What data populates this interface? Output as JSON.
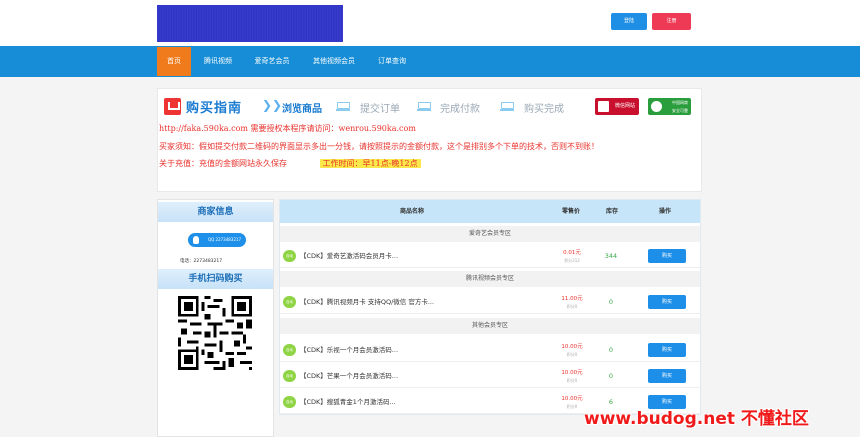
{
  "header": {
    "login_label": "登陆",
    "register_label": "注册"
  },
  "nav": {
    "items": [
      "首页",
      "腾讯视频",
      "爱奇艺会员",
      "其他视频会员",
      "订单查询"
    ]
  },
  "guide": {
    "title": "购买指南",
    "steps": [
      "浏览商品",
      "提交订单",
      "完成付款",
      "购买完成"
    ],
    "badge_red": "微信网站",
    "badge_green": [
      "中国网商",
      "安全可靠"
    ],
    "line1": "http://faka.590ka.com   需要授权本程序请访问：wenrou.590ka.com",
    "line2": "买家须知：假如提交付款二维码的界面显示多出一分钱，请按照提示的金额付款，这个是排别多个下单的技术，否则不到账！",
    "line3_text": "关于充值：充值的金额网站永久保存",
    "line3_highlight": "工作时间：早11点-晚12点"
  },
  "sidebar": {
    "merchant_title": "商家信息",
    "qq_label": "QQ 2273483217",
    "phone_label": "电话：2273483217",
    "scan_title": "手机扫码购买"
  },
  "products": {
    "headers": {
      "name": "商品名称",
      "price": "零售价",
      "stock": "库存",
      "action": "操作"
    },
    "sections": [
      {
        "category": "爱奇艺会员专区",
        "items": [
          {
            "tag": "自动",
            "name": "【CDK】爱奇艺激活码会员月卡...",
            "price": "0.01元",
            "points": "积分312",
            "stock": "344",
            "buy": "购买"
          }
        ]
      },
      {
        "category": "腾讯视频会员专区",
        "items": [
          {
            "tag": "自动",
            "name": "【CDK】腾讯视频月卡 支持QQ/微信 官方卡...",
            "price": "11.00元",
            "points": "积分0",
            "stock": "0",
            "buy": "购买"
          }
        ]
      },
      {
        "category": "其他会员专区",
        "items": [
          {
            "tag": "自动",
            "name": "【CDK】乐视一个月会员激活码...",
            "price": "10.00元",
            "points": "积分0",
            "stock": "0",
            "buy": "购买"
          },
          {
            "tag": "自动",
            "name": "【CDK】芒果一个月会员激活码...",
            "price": "10.00元",
            "points": "积分0",
            "stock": "0",
            "buy": "购买"
          },
          {
            "tag": "自动",
            "name": "【CDK】搜狐青金1个月激活码...",
            "price": "10.00元",
            "points": "积分0",
            "stock": "6",
            "buy": "购买"
          }
        ]
      }
    ]
  },
  "watermark": "www.budog.net 不懂社区",
  "colors": {
    "nav": "#168dd6",
    "nav_active": "#f07b1d",
    "accent": "#1e8fe8",
    "danger": "#e8322c"
  }
}
